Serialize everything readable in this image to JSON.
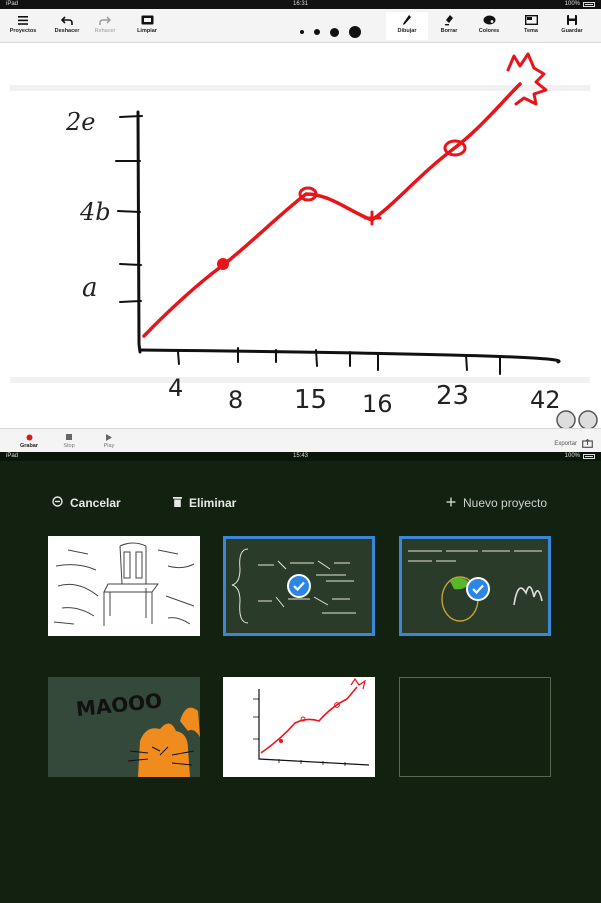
{
  "top_screen": {
    "status": {
      "carrier": "iPad",
      "time": "16:31",
      "battery": "100%"
    },
    "toolbar": {
      "proyectos": "Proyectos",
      "deshacer": "Deshacer",
      "rehacer": "Rehacer",
      "limpiar": "Limpiar",
      "dibujar": "Dibujar",
      "borrar": "Borrar",
      "colores": "Colores",
      "tema": "Tema",
      "guardar": "Guardar"
    },
    "pen_sizes": [
      "small",
      "medium",
      "large",
      "x-large"
    ],
    "drawing": {
      "stroke_color": "#e8141b",
      "axis_color": "#111111",
      "y_labels": [
        "2e",
        "4b",
        "a"
      ],
      "x_labels": [
        "4",
        "8",
        "15",
        "16",
        "23",
        "42"
      ]
    },
    "bottombar": {
      "grabar": "Grabar",
      "stop": "Stop",
      "play": "Play",
      "exportar": "Exportar"
    }
  },
  "bottom_screen": {
    "status": {
      "carrier": "iPad",
      "time": "15:43",
      "battery": "100%"
    },
    "header": {
      "cancel": "Cancelar",
      "delete": "Eliminar",
      "new_project": "Nuevo proyecto"
    },
    "thumbnails": [
      {
        "name": "chair-sketch",
        "selected": false,
        "background": "#ffffff"
      },
      {
        "name": "math-formulas",
        "selected": true,
        "background": "#2b3b29"
      },
      {
        "name": "handwritten-note",
        "selected": true,
        "background": "#2b3b29"
      },
      {
        "name": "cat-maooo",
        "selected": false,
        "background": "#35493a",
        "text": "MAOOO"
      },
      {
        "name": "line-graph",
        "selected": false,
        "background": "#ffffff"
      },
      {
        "name": "empty-project",
        "selected": false,
        "background": "#132111"
      }
    ],
    "colors": {
      "background": "#132111",
      "selection": "#3b86d6",
      "check": "#2d86e6"
    }
  }
}
